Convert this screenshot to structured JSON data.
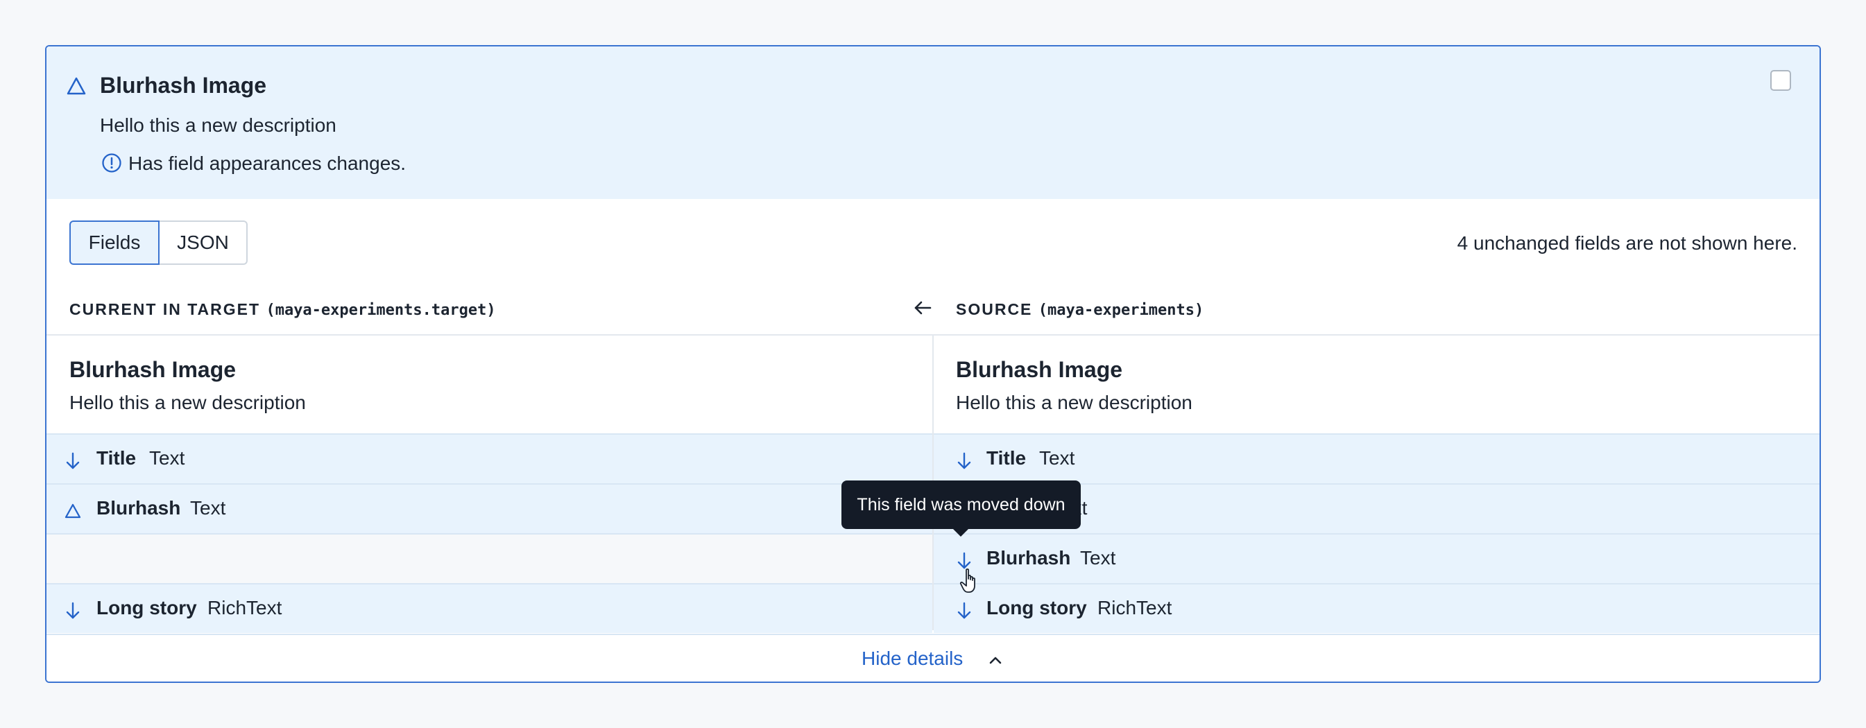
{
  "header": {
    "title": "Blurhash Image",
    "description": "Hello this a new description",
    "info": "Has field appearances changes.",
    "status_icon": "triangle-icon",
    "accent_color": "#3b74d1",
    "highlight_bg": "#e8f3fd"
  },
  "tabs": [
    {
      "label": "Fields",
      "active": true
    },
    {
      "label": "JSON",
      "active": false
    }
  ],
  "unchanged_note": "4 unchanged fields are not shown here.",
  "columns": {
    "left": {
      "label": "CURRENT IN TARGET",
      "env": "(maya-experiments.target)"
    },
    "right": {
      "label": "SOURCE",
      "env": "(maya-experiments)"
    }
  },
  "content_type": {
    "left": {
      "title": "Blurhash Image",
      "description": "Hello this a new description"
    },
    "right": {
      "title": "Blurhash Image",
      "description": "Hello this a new description"
    }
  },
  "fields": {
    "left": [
      {
        "name": "Title",
        "type": "Text",
        "icon": "arrow-down-icon"
      },
      {
        "name": "Blurhash",
        "type": "Text",
        "icon": "triangle-icon"
      },
      null,
      {
        "name": "Long story",
        "type": "RichText",
        "icon": "arrow-down-icon"
      }
    ],
    "right": [
      {
        "name": "Title",
        "type": "Text",
        "icon": "arrow-down-icon"
      },
      {
        "name": "",
        "type": "Text",
        "icon": ""
      },
      {
        "name": "Blurhash",
        "type": "Text",
        "icon": "arrow-down-icon"
      },
      {
        "name": "Long story",
        "type": "RichText",
        "icon": "arrow-down-icon"
      }
    ]
  },
  "tooltip": "This field was moved down",
  "footer": {
    "hide_label": "Hide details"
  }
}
